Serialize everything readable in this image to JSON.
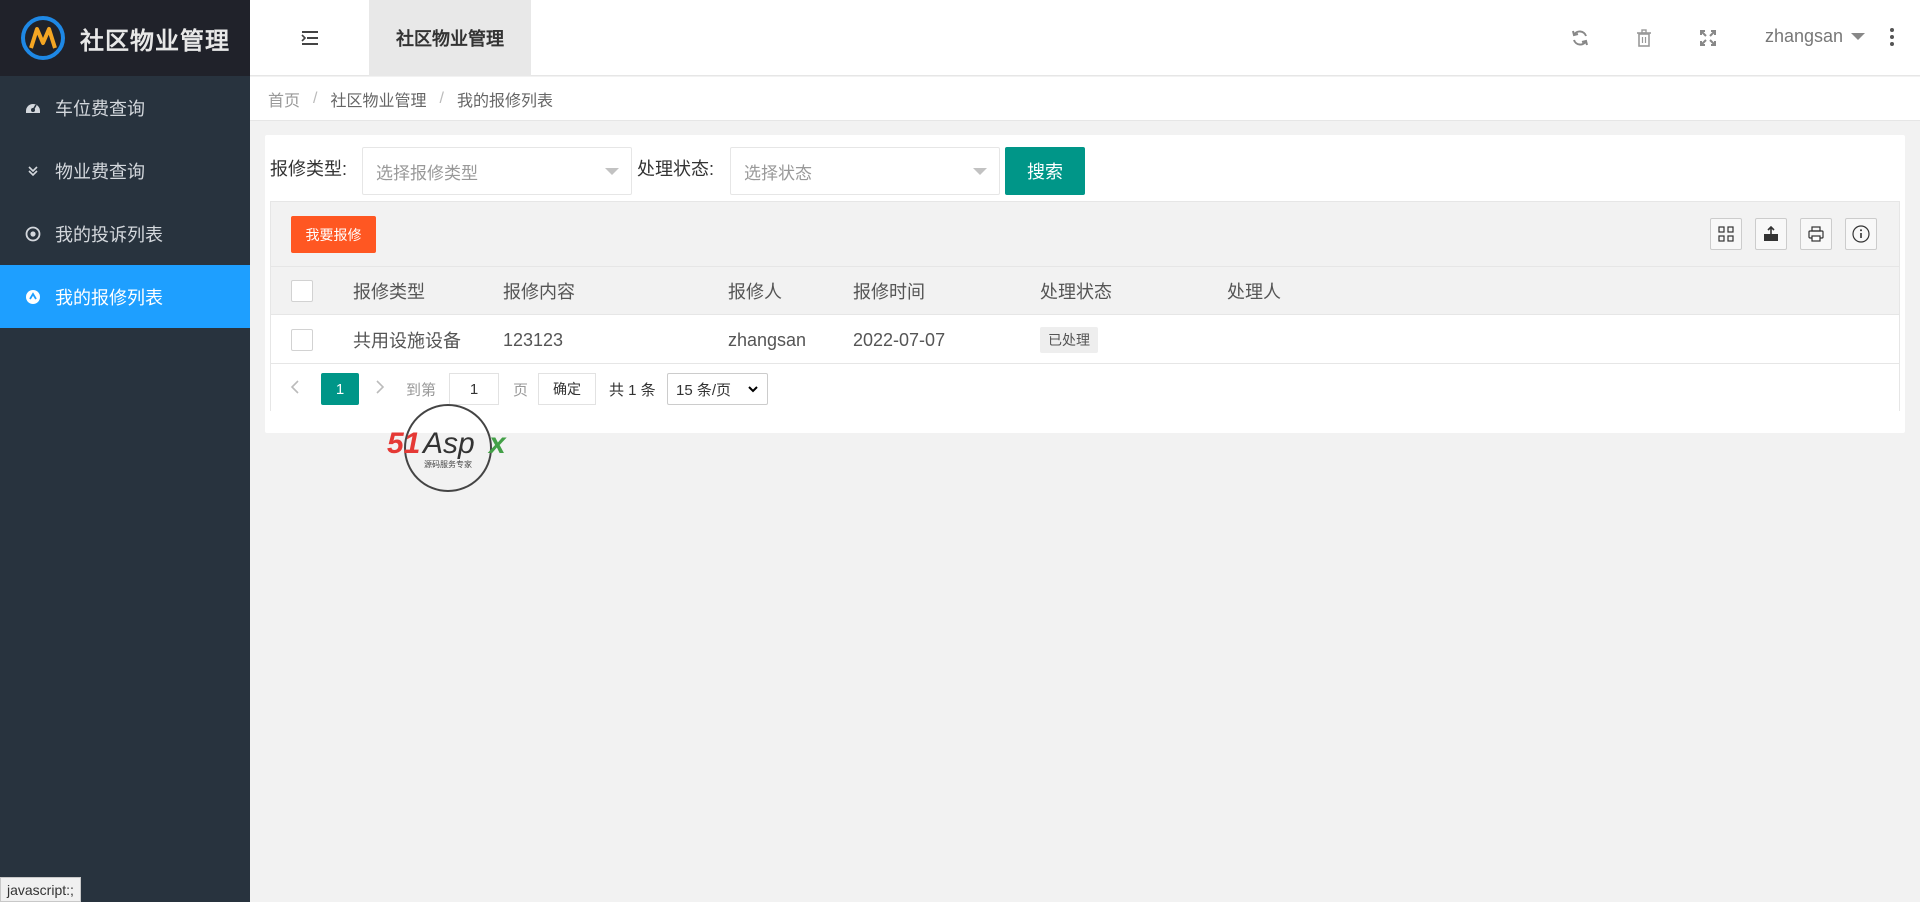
{
  "app": {
    "title": "社区物业管理"
  },
  "sidebar": {
    "items": [
      {
        "label": "车位费查询",
        "icon": "dashboard-icon"
      },
      {
        "label": "物业费查询",
        "icon": "double-chevron-down-icon"
      },
      {
        "label": "我的投诉列表",
        "icon": "target-circle-icon"
      },
      {
        "label": "我的报修列表",
        "icon": "circle-arrow-icon",
        "active": true
      }
    ]
  },
  "header": {
    "tab_label": "社区物业管理",
    "user_name": "zhangsan"
  },
  "breadcrumb": {
    "items": [
      "首页",
      "社区物业管理",
      "我的报修列表"
    ],
    "separator": "/"
  },
  "search": {
    "repair_type_label": "报修类型:",
    "repair_type_placeholder": "选择报修类型",
    "status_label": "处理状态:",
    "status_placeholder": "选择状态",
    "search_button": "搜索"
  },
  "toolbar": {
    "add_button": "我要报修",
    "tools": [
      "columns-icon",
      "export-icon",
      "print-icon",
      "info-icon"
    ]
  },
  "table": {
    "columns": [
      "报修类型",
      "报修内容",
      "报修人",
      "报修时间",
      "处理状态",
      "处理人"
    ],
    "rows": [
      {
        "type": "共用设施设备",
        "content": "123123",
        "reporter": "zhangsan",
        "time": "2022-07-07",
        "status": "已处理",
        "handler": ""
      }
    ]
  },
  "pagination": {
    "current_page": "1",
    "goto_label": "到第",
    "goto_value": "1",
    "page_unit": "页",
    "confirm": "确定",
    "total": "共 1 条",
    "page_size": "15 条/页"
  },
  "watermark": {
    "brand": "51Aspx",
    "tagline": "源码服务专家"
  },
  "status_bar": {
    "text": "javascript:;"
  },
  "colors": {
    "sidebar": "#28333e",
    "active": "#1e9fff",
    "primary": "#009688",
    "warn": "#ff5722"
  }
}
